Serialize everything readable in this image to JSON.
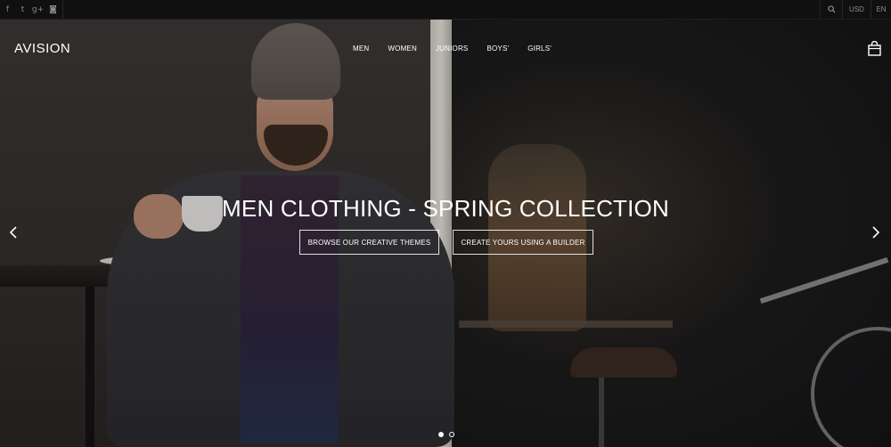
{
  "topbar": {
    "social": [
      {
        "icon": "facebook-icon",
        "glyph": "f"
      },
      {
        "icon": "twitter-icon",
        "glyph": "t"
      },
      {
        "icon": "google-plus-icon",
        "glyph": "g+"
      },
      {
        "icon": "instagram-icon",
        "glyph": "◙"
      }
    ],
    "search_icon": "search-icon",
    "currency": "USD",
    "language": "EN"
  },
  "header": {
    "logo": "AVISION",
    "nav": [
      "MEN",
      "WOMEN",
      "JUNIORS",
      "BOYS'",
      "GIRLS'"
    ],
    "cart_icon": "shopping-bag-icon"
  },
  "hero": {
    "headline": "MEN CLOTHING - SPRING COLLECTION",
    "cta_primary": "BROWSE OUR CREATIVE THEMES",
    "cta_secondary": "CREATE YOURS USING A BUILDER",
    "slide_count": 2,
    "active_slide": 1
  },
  "colors": {
    "text": "#ffffff",
    "topbar_bg": "#101010"
  }
}
